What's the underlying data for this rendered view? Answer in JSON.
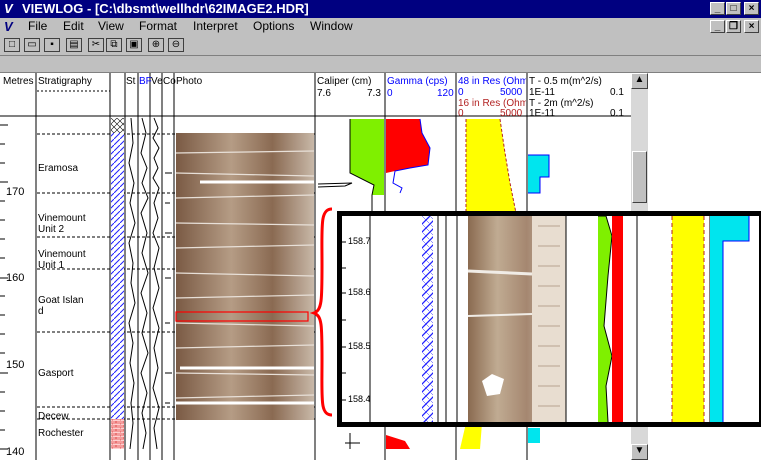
{
  "window": {
    "title": "VIEWLOG - [C:\\dbsmt\\wellhdr\\62IMAGE2.HDR]",
    "app_icon": "V"
  },
  "menu": [
    "File",
    "Edit",
    "View",
    "Format",
    "Interpret",
    "Options",
    "Window"
  ],
  "toolbar_icons": [
    "new-icon",
    "open-icon",
    "save-icon",
    "print-icon",
    "cut-icon",
    "copy-icon",
    "paste-icon",
    "zoom-in-icon",
    "zoom-out-icon"
  ],
  "columns": {
    "metres": "Metres",
    "stratigraphy": "Stratigraphy",
    "st": "St",
    "bf": "BF",
    "ve": "Ve",
    "co": "Co",
    "photo": "Photo"
  },
  "tracks": {
    "caliper": {
      "label": "Caliper (cm)",
      "min": "7.6",
      "max": "7.3",
      "color": "#000000"
    },
    "gamma": {
      "label": "Gamma (cps)",
      "min": "0",
      "max": "120",
      "color": "#0000ff"
    },
    "res48": {
      "label": "48 in Res (Ohm-",
      "min": "0",
      "max": "5000",
      "color": "#0000ff"
    },
    "res16": {
      "label": "16 in Res (Ohm-",
      "min": "0",
      "max": "5000",
      "color": "#b22222"
    },
    "t05": {
      "label": "T - 0.5 m(m^2/s)",
      "min": "1E-11",
      "max": "0.1"
    },
    "t2": {
      "label": "T - 2m (m^2/s)",
      "min": "1E-11",
      "max": "0.1"
    }
  },
  "depth_labels": [
    "170",
    "160",
    "150",
    "140"
  ],
  "formations": [
    "Eramosa",
    "Vinemount Unit 2",
    "Vinemount Unit 1",
    "Goat Islan d",
    "Gasport",
    "Decew",
    "Rochester"
  ],
  "zoom_depths": [
    "158.7",
    "158.6",
    "158.5",
    "158.4"
  ]
}
